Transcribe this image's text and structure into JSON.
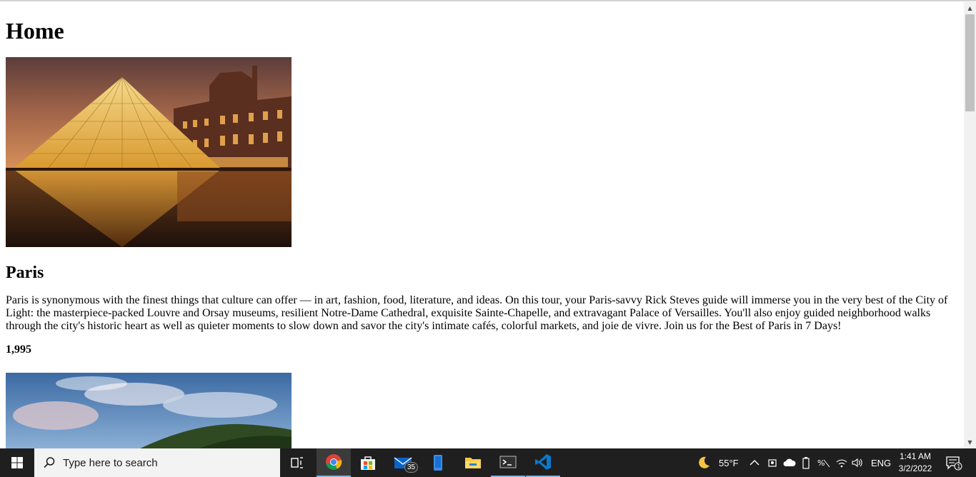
{
  "page": {
    "heading": "Home",
    "tours": [
      {
        "title": "Paris",
        "description": "Paris is synonymous with the finest things that culture can offer — in art, fashion, food, literature, and ideas. On this tour, your Paris-savvy Rick Steves guide will immerse you in the very best of the City of Light: the masterpiece-packed Louvre and Orsay museums, resilient Notre-Dame Cathedral, exquisite Sainte-Chapelle, and extravagant Palace of Versailles. You'll also enjoy guided neighborhood walks through the city's historic heart as well as quieter moments to slow down and savor the city's intimate cafés, colorful markets, and joie de vivre. Join us for the Best of Paris in 7 Days!",
        "price": "1,995"
      }
    ]
  },
  "taskbar": {
    "search_placeholder": "Type here to search",
    "mail_badge": "35",
    "weather": "55°F",
    "language": "ENG",
    "time": "1:41 AM",
    "date": "3/2/2022",
    "notification_count": "1"
  }
}
